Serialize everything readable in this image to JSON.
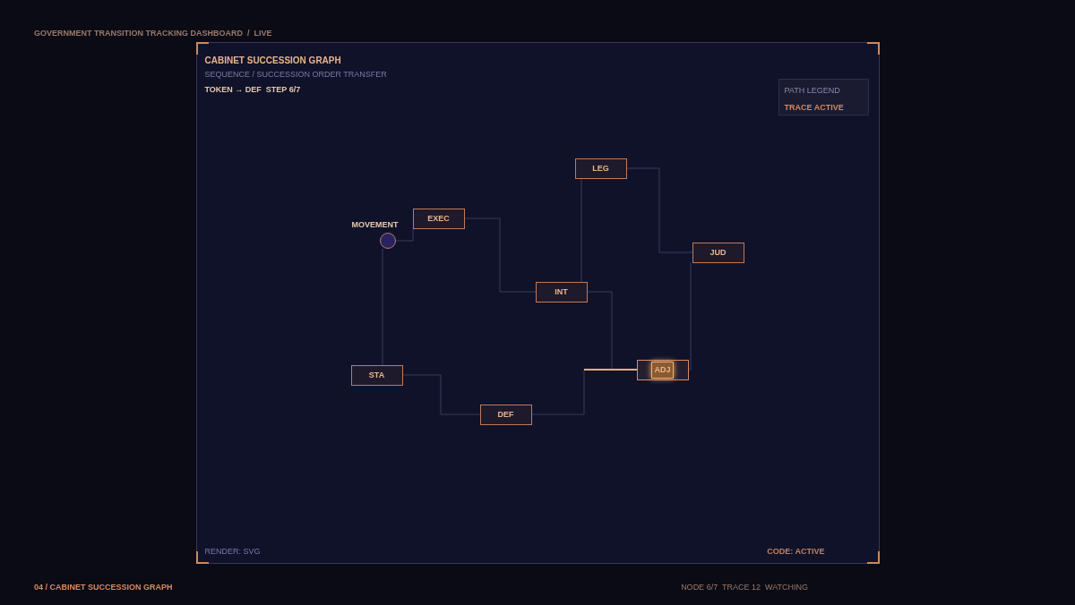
{
  "breadcrumb": "GOVERNMENT TRANSITION TRACKING DASHBOARD  /  LIVE",
  "panel": {
    "title": "CABINET SUCCESSION GRAPH",
    "subtitle": "SEQUENCE / SUCCESSION ORDER TRANSFER",
    "status": "TOKEN → DEF  STEP 6/7",
    "legend": {
      "heading": "PATH LEGEND",
      "item": "TRACE ACTIVE"
    },
    "footer_left": "RENDER: SVG",
    "footer_right": "CODE: ACTIVE"
  },
  "graph": {
    "origin_label": "MOVEMENT",
    "nodes": [
      {
        "label": "LEG",
        "active": false
      },
      {
        "label": "EXEC",
        "active": false
      },
      {
        "label": "JUD",
        "active": false
      },
      {
        "label": "INT",
        "active": false
      },
      {
        "label": "STA",
        "active": false
      },
      {
        "label": "DEF",
        "active": false
      },
      {
        "label": "ADJ",
        "active": true
      }
    ]
  },
  "footer": {
    "left": "04 / CABINET SUCCESSION GRAPH",
    "right": "NODE 6/7  TRACE 12  WATCHING"
  }
}
